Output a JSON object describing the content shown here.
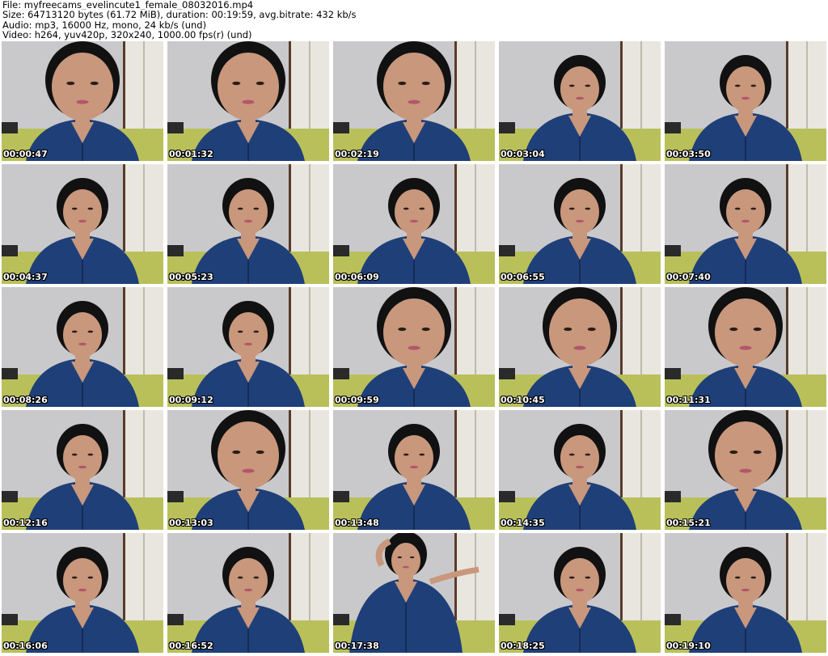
{
  "header": {
    "file_line": "File: myfreecams_evelincute1_female_08032016.mp4",
    "size_line": "Size: 64713120 bytes (61.72 MiB), duration: 00:19:59, avg.bitrate: 432 kb/s",
    "audio_line": "Audio: mp3, 16000 Hz, mono, 24 kb/s (und)",
    "video_line": "Video: h264, yuv420p, 320x240, 1000.00 fps(r) (und)"
  },
  "thumbnails": [
    {
      "timestamp": "00:00:47",
      "pose": "close"
    },
    {
      "timestamp": "00:01:32",
      "pose": "close"
    },
    {
      "timestamp": "00:02:19",
      "pose": "close"
    },
    {
      "timestamp": "00:03:04",
      "pose": "mid"
    },
    {
      "timestamp": "00:03:50",
      "pose": "mid"
    },
    {
      "timestamp": "00:04:37",
      "pose": "mid"
    },
    {
      "timestamp": "00:05:23",
      "pose": "mid"
    },
    {
      "timestamp": "00:06:09",
      "pose": "mid"
    },
    {
      "timestamp": "00:06:55",
      "pose": "mid"
    },
    {
      "timestamp": "00:07:40",
      "pose": "mid"
    },
    {
      "timestamp": "00:08:26",
      "pose": "mid"
    },
    {
      "timestamp": "00:09:12",
      "pose": "mid"
    },
    {
      "timestamp": "00:09:59",
      "pose": "close"
    },
    {
      "timestamp": "00:10:45",
      "pose": "close"
    },
    {
      "timestamp": "00:11:31",
      "pose": "close"
    },
    {
      "timestamp": "00:12:16",
      "pose": "mid"
    },
    {
      "timestamp": "00:13:03",
      "pose": "close"
    },
    {
      "timestamp": "00:13:48",
      "pose": "mid"
    },
    {
      "timestamp": "00:14:35",
      "pose": "mid"
    },
    {
      "timestamp": "00:15:21",
      "pose": "close"
    },
    {
      "timestamp": "00:16:06",
      "pose": "mid"
    },
    {
      "timestamp": "00:16:52",
      "pose": "mid"
    },
    {
      "timestamp": "00:17:38",
      "pose": "stretch"
    },
    {
      "timestamp": "00:18:25",
      "pose": "mid"
    },
    {
      "timestamp": "00:19:10",
      "pose": "mid"
    }
  ],
  "colors": {
    "wall": "#c9c9cc",
    "door": "#e8e6df",
    "door_frame": "#5a3a2a",
    "desk": "#b9c05a",
    "denim": "#1f3f78",
    "denim_dark": "#152c57",
    "skin": "#c8977c",
    "hair": "#111111",
    "timestamp_text": "#ffffff"
  }
}
